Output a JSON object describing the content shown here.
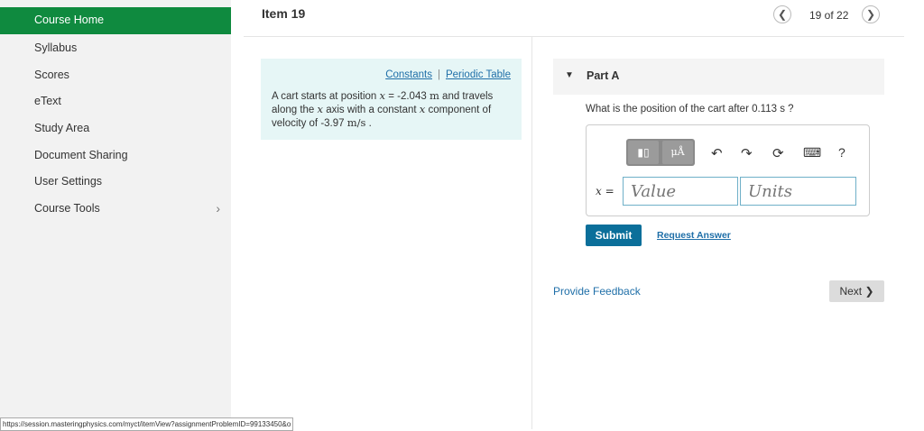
{
  "sidebar": {
    "items": [
      {
        "label": "Course Home"
      },
      {
        "label": "Syllabus"
      },
      {
        "label": "Scores"
      },
      {
        "label": "eText"
      },
      {
        "label": "Study Area"
      },
      {
        "label": "Document Sharing"
      },
      {
        "label": "User Settings"
      },
      {
        "label": "Course Tools"
      }
    ]
  },
  "status_url": "https://session.masteringphysics.com/myct/itemView?assignmentProblemID=99133450&o",
  "header": {
    "title": "Item 19",
    "pager": "19 of 22"
  },
  "info_box": {
    "constants_link": "Constants",
    "separator": "|",
    "periodic_link": "Periodic Table",
    "text_1": "A cart starts at position ",
    "x_var": "x",
    "text_2": " = -2.043 ",
    "unit_m": "m",
    "text_3": " and travels along the ",
    "text_4": " axis with a constant ",
    "text_5": " component of velocity of -3.97 ",
    "unit_ms": "m/s",
    "text_6": " ."
  },
  "part": {
    "title": "Part A",
    "question": "What is the position of the cart after 0.113  s ?",
    "x_label": "x =",
    "value_placeholder": "Value",
    "units_placeholder": "Units",
    "toolbar": {
      "template_glyph": "▮▯",
      "mu_glyph": "μÅ",
      "help_glyph": "?"
    },
    "submit": "Submit",
    "request_answer": "Request Answer"
  },
  "footer": {
    "feedback": "Provide Feedback",
    "next": "Next ❯"
  }
}
